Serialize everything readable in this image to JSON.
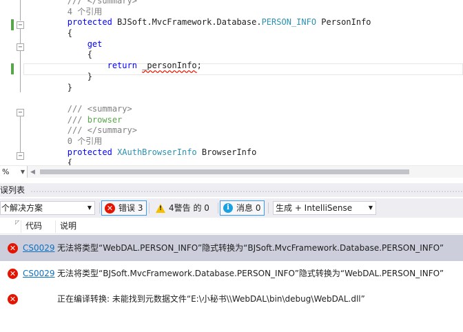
{
  "editor": {
    "lines": [
      {
        "indent": "        ",
        "tokens": [
          {
            "t": "/// </summary>",
            "c": "c-doc"
          }
        ]
      },
      {
        "indent": "        ",
        "tokens": [
          {
            "t": "4 个引用",
            "c": "c-ref"
          }
        ]
      },
      {
        "indent": "        ",
        "tokens": [
          {
            "t": "protected",
            "c": "c-kw"
          },
          {
            "t": " BJSoft.MvcFramework.Database.",
            "c": "c-ident"
          },
          {
            "t": "PERSON_INFO",
            "c": "c-type"
          },
          {
            "t": " PersonInfo",
            "c": "c-ident"
          }
        ]
      },
      {
        "indent": "        ",
        "tokens": [
          {
            "t": "{",
            "c": "c-ident"
          }
        ]
      },
      {
        "indent": "            ",
        "tokens": [
          {
            "t": "get",
            "c": "c-kw"
          }
        ]
      },
      {
        "indent": "            ",
        "tokens": [
          {
            "t": "{",
            "c": "c-ident"
          }
        ]
      },
      {
        "indent": "                ",
        "tokens": [
          {
            "t": "return",
            "c": "c-kw"
          },
          {
            "t": " ",
            "c": "c-ident"
          },
          {
            "t": "_personInfo",
            "c": "c-ident squiggle"
          },
          {
            "t": ";",
            "c": "c-ident"
          }
        ]
      },
      {
        "indent": "            ",
        "tokens": [
          {
            "t": "}",
            "c": "c-ident"
          }
        ]
      },
      {
        "indent": "        ",
        "tokens": [
          {
            "t": "}",
            "c": "c-ident"
          }
        ]
      },
      {
        "indent": "",
        "tokens": [
          {
            "t": "",
            "c": "c-ident"
          }
        ]
      },
      {
        "indent": "        ",
        "tokens": [
          {
            "t": "/// <summary>",
            "c": "c-doc"
          }
        ]
      },
      {
        "indent": "        ",
        "tokens": [
          {
            "t": "/// ",
            "c": "c-doc"
          },
          {
            "t": "browser",
            "c": "c-comment"
          }
        ]
      },
      {
        "indent": "        ",
        "tokens": [
          {
            "t": "/// </summary>",
            "c": "c-doc"
          }
        ]
      },
      {
        "indent": "        ",
        "tokens": [
          {
            "t": "0 个引用",
            "c": "c-ref"
          }
        ]
      },
      {
        "indent": "        ",
        "tokens": [
          {
            "t": "protected",
            "c": "c-kw"
          },
          {
            "t": " ",
            "c": "c-ident"
          },
          {
            "t": "XAuthBrowserInfo",
            "c": "c-type"
          },
          {
            "t": " BrowserInfo",
            "c": "c-ident"
          }
        ]
      },
      {
        "indent": "        ",
        "tokens": [
          {
            "t": "{",
            "c": "c-ident"
          }
        ]
      }
    ],
    "zoom_label": "%",
    "colors": {
      "change_bar": "#57a64a",
      "keyword": "#0000ff",
      "type": "#2b91af",
      "comment": "#57a64a"
    }
  },
  "error_list": {
    "title": "误列表",
    "scope": "个解决方案",
    "filters": {
      "errors_label": "错误 3",
      "warnings_label": "4警告 的 0",
      "messages_label": "消息 0"
    },
    "build_source": "生成 + IntelliSense",
    "columns": {
      "code": "代码",
      "description": "说明"
    },
    "rows": [
      {
        "code": "CS0029",
        "description": "无法将类型“WebDAL.PERSON_INFO”隐式转换为“BJSoft.MvcFramework.Database.PERSON_INFO”"
      },
      {
        "code": "CS0029",
        "description": "无法将类型“BJSoft.MvcFramework.Database.PERSON_INFO”隐式转换为“WebDAL.PERSON_INFO”"
      },
      {
        "code": "",
        "description": "正在编译转换: 未能找到元数据文件“E:\\小秘书\\\\WebDAL\\bin\\debug\\WebDAL.dll”"
      }
    ],
    "colors": {
      "error": "#e51400",
      "warning": "#f5c000",
      "info": "#1ba1e2",
      "selected_row": "#cccedb",
      "link": "#0e70c0"
    }
  }
}
